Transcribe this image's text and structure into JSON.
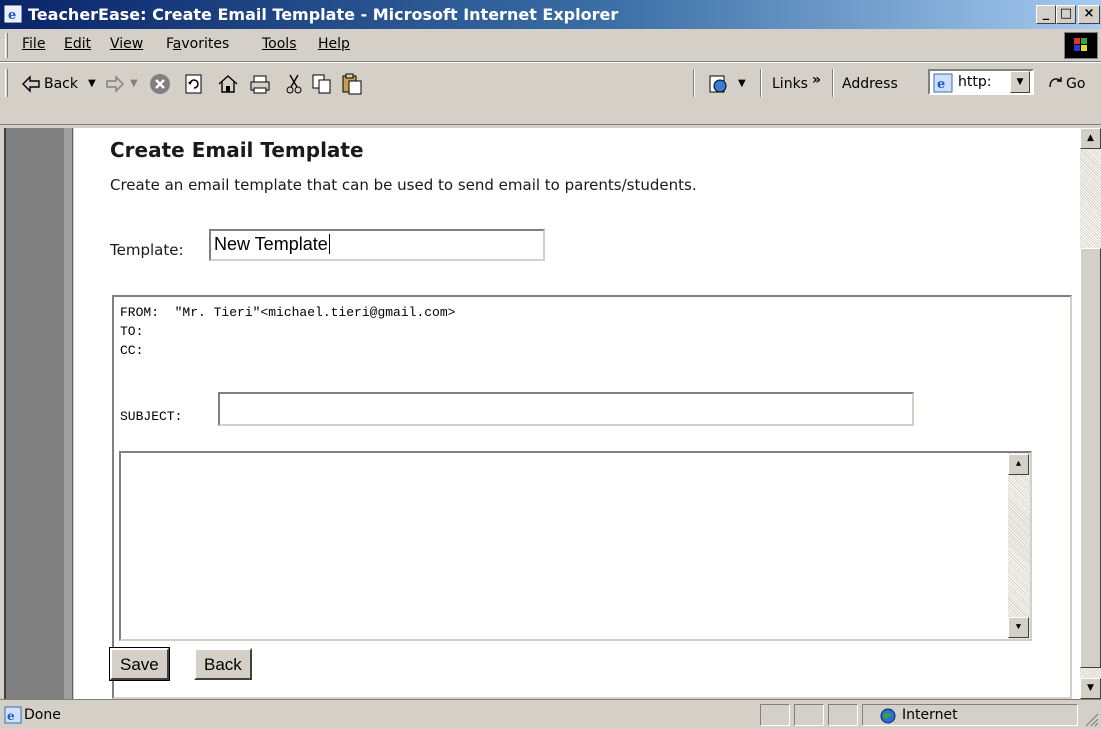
{
  "window": {
    "title": "TeacherEase: Create Email Template - Microsoft Internet Explorer",
    "minimize_label": "_",
    "maximize_label": "□",
    "close_label": "×"
  },
  "menubar": {
    "items": [
      {
        "label": "File",
        "mnemonic_index": 0
      },
      {
        "label": "Edit",
        "mnemonic_index": 0
      },
      {
        "label": "View",
        "mnemonic_index": 0
      },
      {
        "label": "Favorites",
        "mnemonic_index": 1
      },
      {
        "label": "Tools",
        "mnemonic_index": 0
      },
      {
        "label": "Help",
        "mnemonic_index": 0
      }
    ]
  },
  "toolbar": {
    "back_label": "Back",
    "links_label": "Links",
    "chevron": "»",
    "address_label": "Address",
    "address_value": "http:",
    "go_label": "Go"
  },
  "page": {
    "heading": "Create Email Template",
    "description": "Create an email template that can be used to send email to parents/students.",
    "template_label": "Template:",
    "template_value": "New Template",
    "from_line": "FROM:  \"Mr. Tieri\"<michael.tieri@gmail.com>",
    "to_line": "TO:",
    "cc_line": "CC:",
    "subject_label": "SUBJECT:",
    "subject_value": "",
    "body_value": "",
    "save_label": "Save",
    "back_label": "Back"
  },
  "statusbar": {
    "status_text": "Done",
    "zone_text": "Internet"
  },
  "icons": [
    "ie-icon",
    "back-arrow-icon",
    "forward-arrow-icon",
    "stop-icon",
    "refresh-icon",
    "home-icon",
    "print-icon",
    "cut-icon",
    "copy-icon",
    "paste-icon",
    "edit-page-icon",
    "globe-icon",
    "go-arrow-icon"
  ]
}
